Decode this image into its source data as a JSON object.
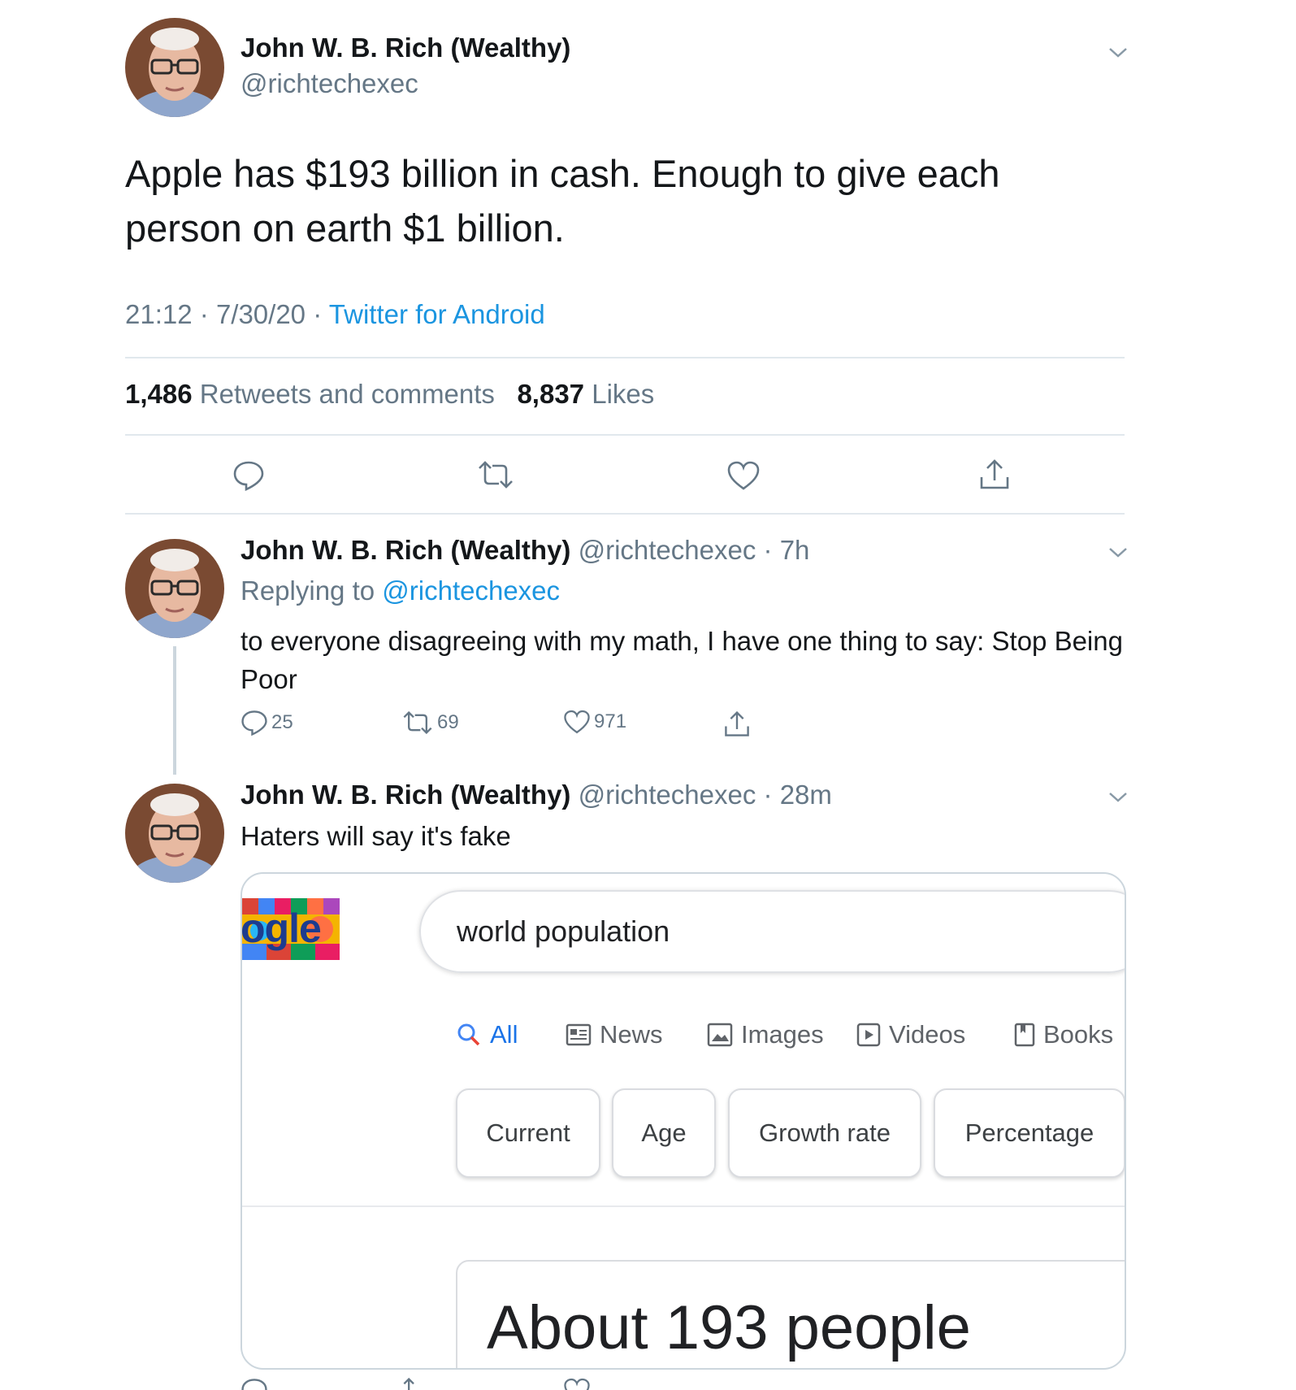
{
  "main_tweet": {
    "name": "John W. B. Rich (Wealthy)",
    "handle": "@richtechexec",
    "text": "Apple has $193 billion in cash. Enough to give each person on earth $1 billion.",
    "time": "21:12",
    "date": "7/30/20",
    "source": "Twitter for Android",
    "retweets_count": "1,486",
    "retweets_label": "Retweets and comments",
    "likes_count": "8,837",
    "likes_label": "Likes",
    "actions": [
      "reply-icon",
      "retweet-icon",
      "like-icon",
      "share-icon"
    ]
  },
  "reply_1": {
    "name": "John W. B. Rich (Wealthy)",
    "handle": "@richtechexec",
    "age": "7h",
    "replying_prefix": "Replying to",
    "replying_to": "@richtechexec",
    "text": "to everyone disagreeing with my math, I have one thing to say: Stop Being Poor",
    "reply_count": "25",
    "retweet_count": "69",
    "like_count": "971"
  },
  "reply_2": {
    "name": "John W. B. Rich (Wealthy)",
    "handle": "@richtechexec",
    "age": "28m",
    "text": "Haters will say it's fake"
  },
  "embedded_image": {
    "logo_fragment": "ogle",
    "search_query": "world population",
    "tabs": [
      "All",
      "News",
      "Images",
      "Videos",
      "Books"
    ],
    "active_tab": "All",
    "chips": [
      "Current",
      "Age",
      "Growth rate",
      "Percentage"
    ],
    "result": "About 193 people"
  },
  "colors": {
    "text": "#14171a",
    "secondary": "#657786",
    "link": "#1b95e0",
    "divider": "#e1e8ed",
    "google_blue": "#1a73e8"
  }
}
